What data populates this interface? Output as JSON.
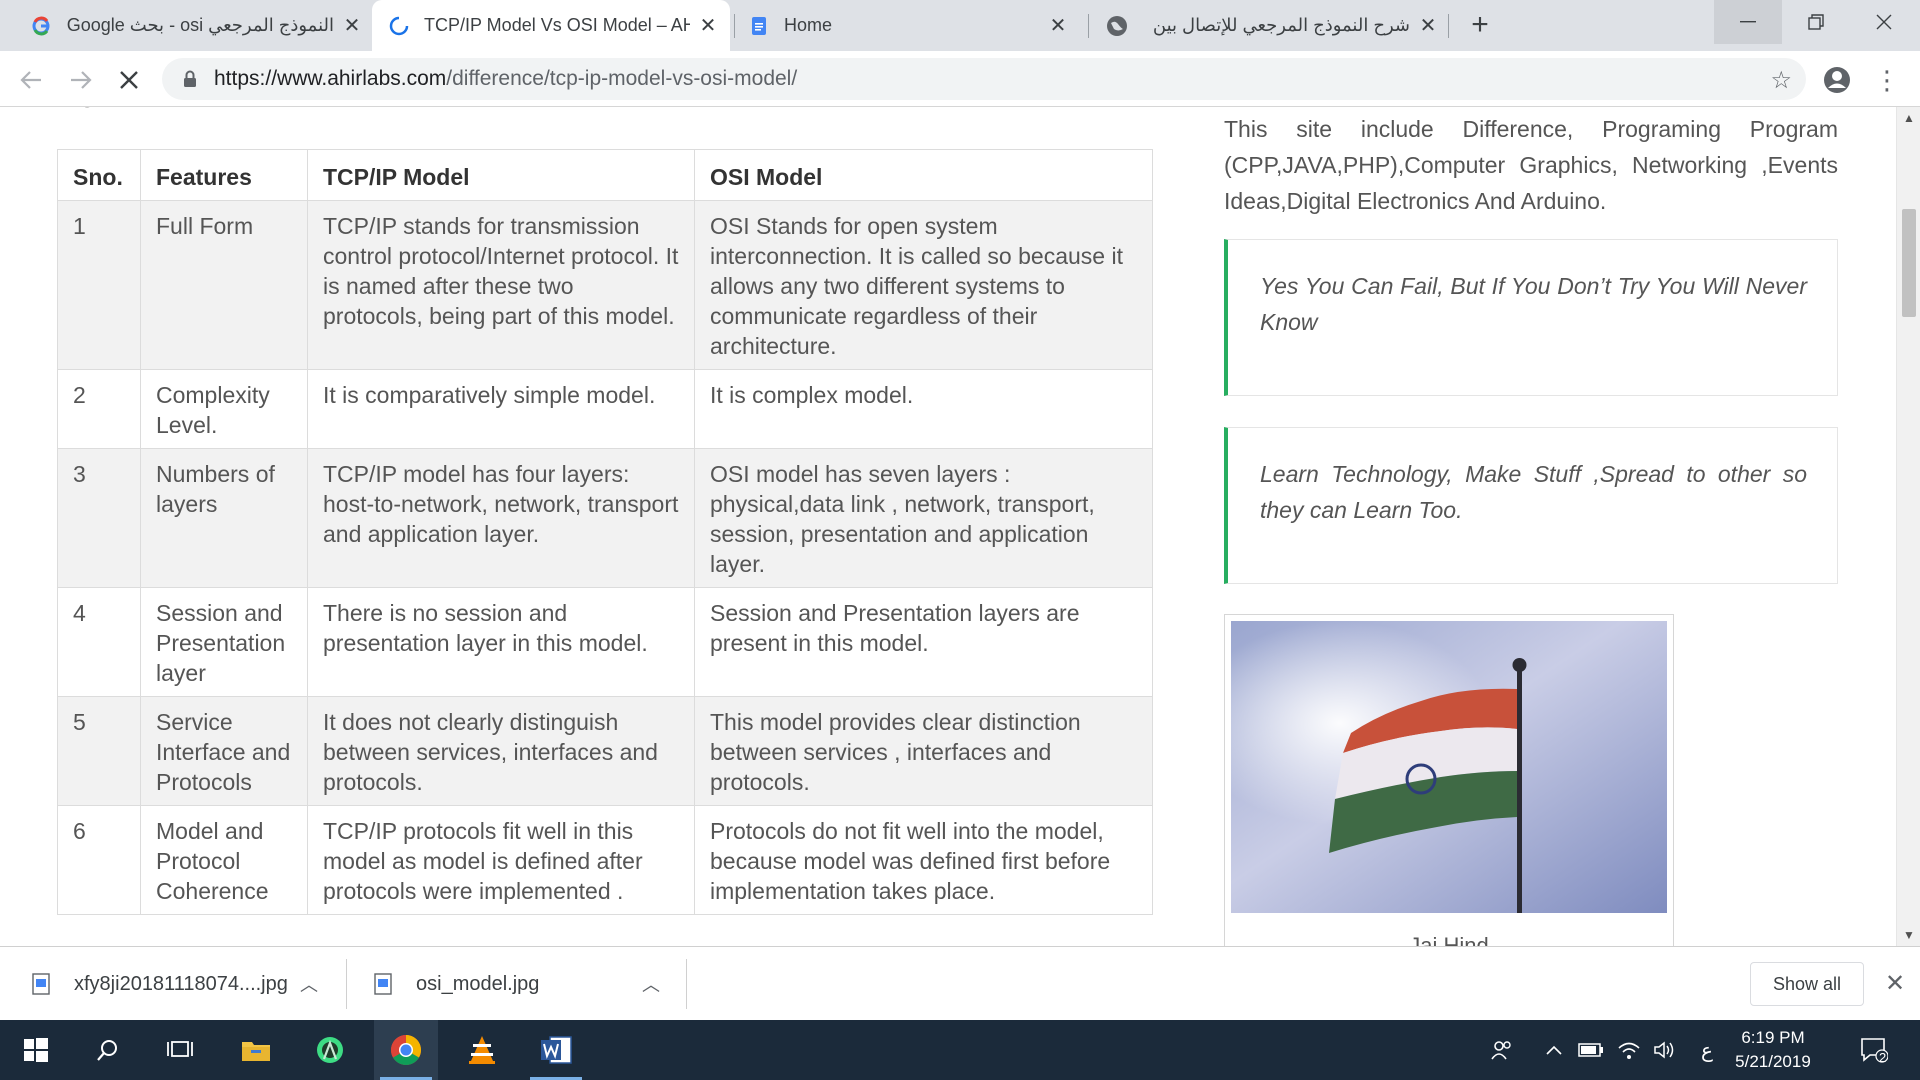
{
  "browser": {
    "tabs": [
      {
        "title": "النموذج المرجعي osi - بحث Google",
        "favicon": "google-g-icon"
      },
      {
        "title": "TCP/IP Model Vs OSI Model – AH",
        "favicon": "loading-spinner-icon"
      },
      {
        "title": "Home",
        "favicon": "docs-icon"
      },
      {
        "title": "شرح النموذج المرجعي للإتصال بين",
        "favicon": "globe-icon"
      }
    ],
    "new_tab": "+",
    "url_host": "https://www.ahirlabs.com",
    "url_path": "/difference/tcp-ip-model-vs-osi-model/"
  },
  "page": {
    "cut_heading": "Form",
    "table": {
      "headers": [
        "Sno.",
        "Features",
        "TCP/IP Model",
        "OSI Model"
      ],
      "rows": [
        [
          "1",
          "Full Form",
          "TCP/IP stands for transmission control protocol/Internet protocol. It is named after these two protocols, being part of this model.",
          "OSI Stands for open system interconnection. It is called so because it allows any two different systems to communicate regardless of their architecture."
        ],
        [
          "2",
          "Complexity Level.",
          "It is comparatively simple model.",
          "It is complex model."
        ],
        [
          "3",
          "Numbers of layers",
          "TCP/IP model has four layers: host-to-network, network, transport and application layer.",
          "OSI model has seven layers : physical,data link , network, transport, session, presentation and application layer."
        ],
        [
          "4",
          "Session and Presentation layer",
          "There is no session and presentation layer in this model.",
          "Session and Presentation layers are present in this model."
        ],
        [
          "5",
          "Service Interface and Protocols",
          "It does not clearly distinguish between services, interfaces and protocols.",
          "This model provides clear distinction between services , interfaces and protocols."
        ],
        [
          "6",
          "Model and Protocol Coherence",
          "TCP/IP protocols fit well in this model as model is defined after protocols were implemented .",
          "Protocols do not fit well into the model, because model was defined first before implementation takes place."
        ]
      ]
    },
    "sidebar": {
      "description": "This site include Difference, Programing Program (CPP,JAVA,PHP),Computer Graphics, Networking ,Events Ideas,Digital Electronics And Arduino.",
      "quote1": "Yes You Can Fail, But If You Don’t Try You Will Never Know",
      "quote2": "Learn Technology, Make Stuff ,Spread to other so they can Learn Too.",
      "image_caption": "Jai Hind",
      "accent_color": "#27ae60"
    }
  },
  "downloads": {
    "items": [
      {
        "name": "xfy8ji20181118074....jpg"
      },
      {
        "name": "osi_model.jpg"
      }
    ],
    "show_all": "Show all"
  },
  "taskbar": {
    "time": "6:19 PM",
    "date": "5/21/2019",
    "lang": "ع",
    "notification_count": "2"
  }
}
